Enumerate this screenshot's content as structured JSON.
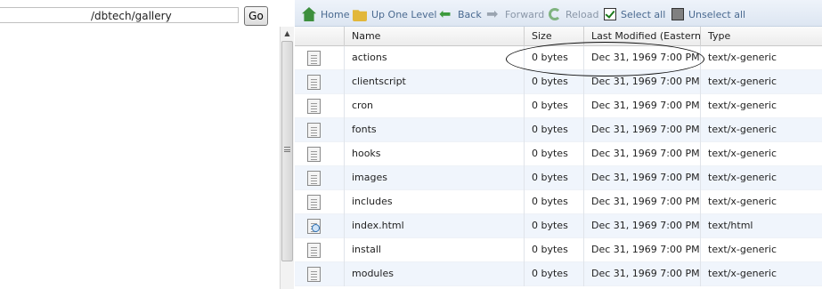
{
  "location": {
    "path_value": "/dbtech/gallery",
    "go_label": "Go"
  },
  "toolbar": [
    {
      "label": "Home",
      "icon": "home-icon",
      "enabled": true
    },
    {
      "label": "Up One Level",
      "icon": "folder-up-icon",
      "enabled": true
    },
    {
      "label": "Back",
      "icon": "back-arrow-icon",
      "enabled": true
    },
    {
      "label": "Forward",
      "icon": "forward-arrow-icon",
      "enabled": false
    },
    {
      "label": "Reload",
      "icon": "reload-icon",
      "enabled": false
    },
    {
      "label": "Select all",
      "icon": "checkbox-checked-icon",
      "enabled": true
    },
    {
      "label": "Unselect all",
      "icon": "checkbox-unchecked-icon",
      "enabled": true
    }
  ],
  "columns": {
    "name": "Name",
    "size": "Size",
    "modified": "Last Modified (Eastern St",
    "type": "Type"
  },
  "files": [
    {
      "name": "actions",
      "size": "0 bytes",
      "modified": "Dec 31, 1969 7:00 PM",
      "type": "text/x-generic",
      "icon": "generic-file-icon"
    },
    {
      "name": "clientscript",
      "size": "0 bytes",
      "modified": "Dec 31, 1969 7:00 PM",
      "type": "text/x-generic",
      "icon": "generic-file-icon"
    },
    {
      "name": "cron",
      "size": "0 bytes",
      "modified": "Dec 31, 1969 7:00 PM",
      "type": "text/x-generic",
      "icon": "generic-file-icon"
    },
    {
      "name": "fonts",
      "size": "0 bytes",
      "modified": "Dec 31, 1969 7:00 PM",
      "type": "text/x-generic",
      "icon": "generic-file-icon"
    },
    {
      "name": "hooks",
      "size": "0 bytes",
      "modified": "Dec 31, 1969 7:00 PM",
      "type": "text/x-generic",
      "icon": "generic-file-icon"
    },
    {
      "name": "images",
      "size": "0 bytes",
      "modified": "Dec 31, 1969 7:00 PM",
      "type": "text/x-generic",
      "icon": "generic-file-icon"
    },
    {
      "name": "includes",
      "size": "0 bytes",
      "modified": "Dec 31, 1969 7:00 PM",
      "type": "text/x-generic",
      "icon": "generic-file-icon"
    },
    {
      "name": "index.html",
      "size": "0 bytes",
      "modified": "Dec 31, 1969 7:00 PM",
      "type": "text/html",
      "icon": "html-file-icon"
    },
    {
      "name": "install",
      "size": "0 bytes",
      "modified": "Dec 31, 1969 7:00 PM",
      "type": "text/x-generic",
      "icon": "generic-file-icon"
    },
    {
      "name": "modules",
      "size": "0 bytes",
      "modified": "Dec 31, 1969 7:00 PM",
      "type": "text/x-generic",
      "icon": "generic-file-icon"
    }
  ]
}
